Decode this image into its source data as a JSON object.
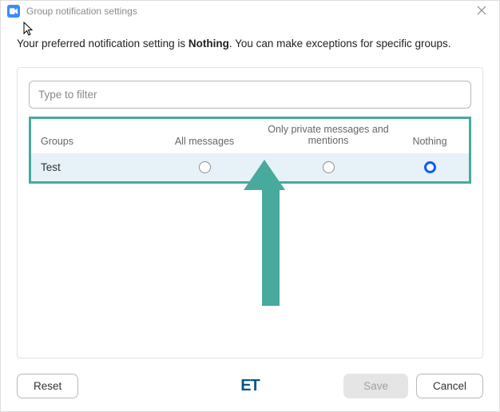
{
  "titlebar": {
    "title": "Group notification settings"
  },
  "description": {
    "prefix": "Your preferred notification setting is ",
    "bold": "Nothing",
    "suffix": ". You can make exceptions for specific groups."
  },
  "filter": {
    "placeholder": "Type to filter"
  },
  "headers": {
    "groups": "Groups",
    "all": "All messages",
    "private": "Only private messages and mentions",
    "nothing": "Nothing"
  },
  "rows": [
    {
      "name": "Test",
      "selected": "nothing"
    }
  ],
  "footer": {
    "reset": "Reset",
    "save": "Save",
    "cancel": "Cancel"
  },
  "watermark": "ET"
}
